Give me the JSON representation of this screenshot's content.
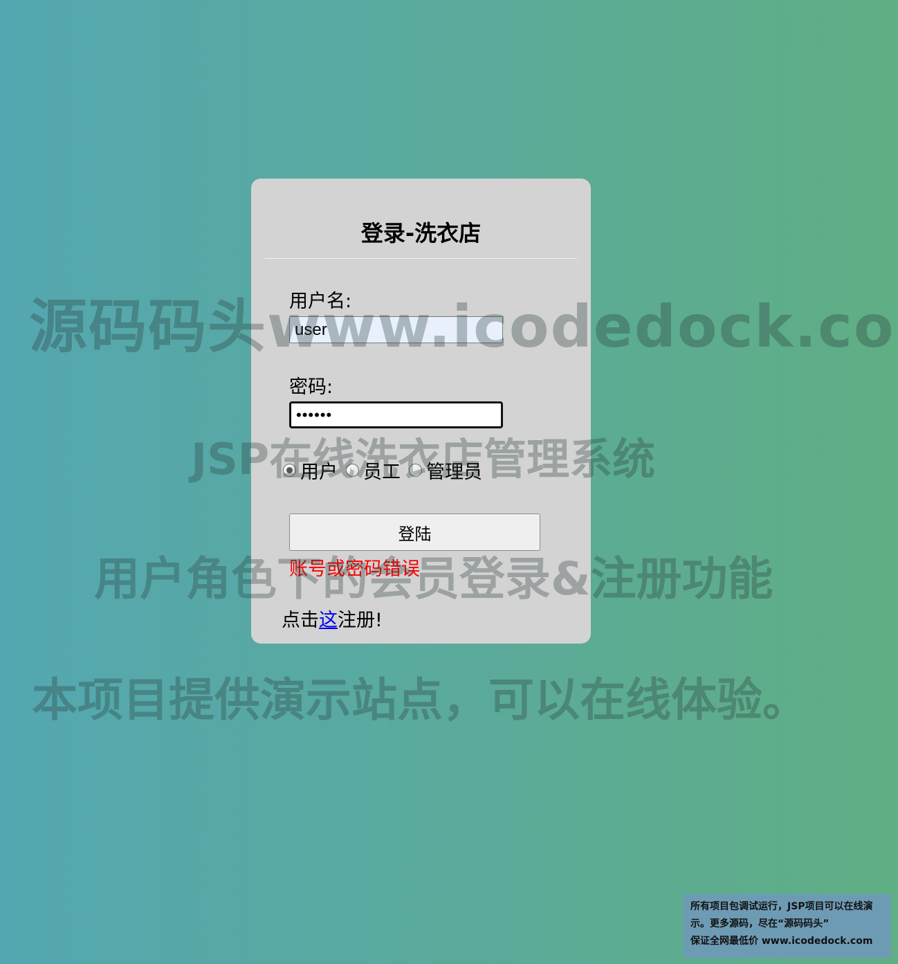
{
  "login": {
    "title": "登录-洗衣店",
    "username_label": "用户名:",
    "username_value": "user",
    "password_label": "密码:",
    "password_value": "••••••",
    "roles": [
      {
        "label": "用户",
        "checked": true
      },
      {
        "label": "员工",
        "checked": false
      },
      {
        "label": "管理员",
        "checked": false
      }
    ],
    "login_button": "登陆",
    "error_message": "账号或密码错误",
    "register_prefix": "点击",
    "register_link": "这",
    "register_suffix": "注册!"
  },
  "watermark": {
    "line1": "源码码头www.icodedock.com",
    "line2": "JSP在线洗衣店管理系统",
    "line3": "用户角色下的会员登录&注册功能",
    "line4": "本项目提供演示站点，可以在线体验。"
  },
  "notice": {
    "line1": "所有项目包调试运行，JSP项目可以在线演",
    "line2": "示。更多源码，尽在“源码码头”",
    "line3": "保证全网最低价 www.icodedock.com"
  },
  "colors": {
    "card_bg": "#d3d3d3",
    "error": "#ff0000",
    "link": "#0000ee",
    "notice_bg": "#6e9bb4"
  }
}
